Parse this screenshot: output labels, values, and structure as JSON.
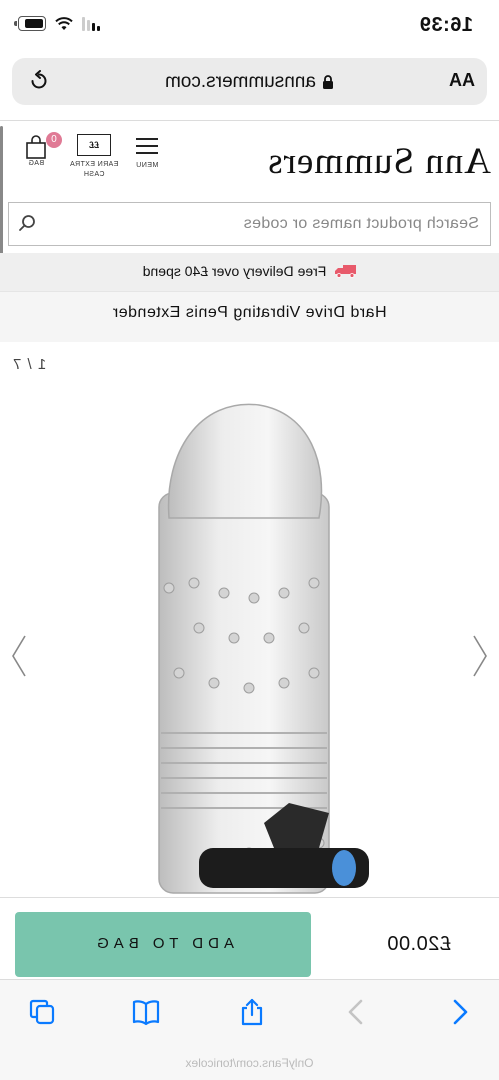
{
  "status_bar": {
    "time": "16:39"
  },
  "browser": {
    "text_size_button": "AA",
    "url": "annsummers.com"
  },
  "site": {
    "logo": "Ann Summers",
    "menu_label": "MENU",
    "earn_label": "EARN EXTRA CASH",
    "earn_box_text": "££",
    "bag_label": "BAG",
    "bag_count": "0",
    "search_placeholder": "Search product names or codes",
    "delivery_text": "Free Delivery over £40 spend"
  },
  "product": {
    "title": "Hard Drive Vibrating Penis Extender",
    "image_counter": "1 / 7",
    "price": "£20.00",
    "add_to_bag_label": "ADD TO BAG"
  },
  "overlay": {
    "watermark": "OnlyFans.com/tonicolex"
  },
  "icons": {
    "reload": "reload-icon",
    "lock": "lock-icon",
    "search": "search-icon",
    "truck": "truck-icon",
    "bag": "bag-icon",
    "hamburger": "hamburger-icon",
    "back": "chevron-left-icon",
    "forward": "chevron-right-icon",
    "share": "share-icon",
    "bookmarks": "book-icon",
    "tabs": "tabs-icon"
  },
  "colors": {
    "add_to_bag": "#79c5ad",
    "badge": "#e07a95",
    "accent_blue": "#0a7aff",
    "delivery_truck": "#e85a6b"
  }
}
